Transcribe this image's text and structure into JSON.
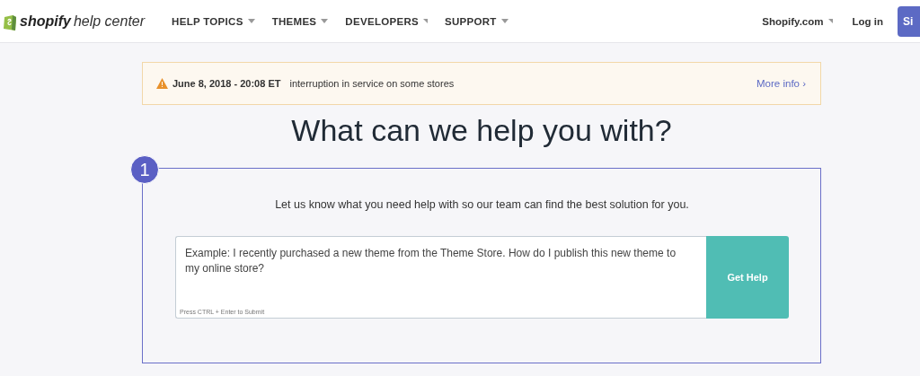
{
  "header": {
    "logo": {
      "brand": "shopify",
      "product": "help center"
    },
    "nav": [
      {
        "label": "HELP TOPICS",
        "kind": "dropdown"
      },
      {
        "label": "THEMES",
        "kind": "dropdown"
      },
      {
        "label": "DEVELOPERS",
        "kind": "external"
      },
      {
        "label": "SUPPORT",
        "kind": "dropdown"
      }
    ],
    "right_links": [
      {
        "label": "Shopify.com",
        "kind": "external"
      },
      {
        "label": "Log in",
        "kind": "plain"
      }
    ],
    "cta_button": "Si"
  },
  "alert": {
    "date": "June 8, 2018 - 20:08 ET",
    "message": "interruption in service on some stores",
    "link": "More info ›"
  },
  "heading": "What can we help you with?",
  "annotation": {
    "number": "1"
  },
  "intro": "Let us know what you need help with so our team can find the best solution for you.",
  "question_form": {
    "placeholder": "Example: I recently purchased a new theme from the Theme Store. How do I publish this new theme to my online store?",
    "hint": "Press CTRL + Enter to Submit",
    "button": "Get Help"
  }
}
